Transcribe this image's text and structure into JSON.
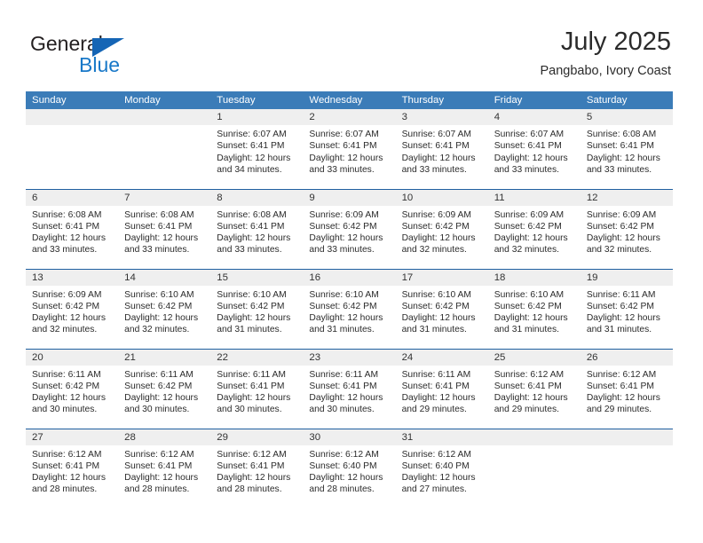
{
  "brand": {
    "name_top": "General",
    "name_bottom": "Blue",
    "accent_color": "#1878c8",
    "triangle_color": "#1565b5"
  },
  "header": {
    "title": "July 2025",
    "subtitle": "Pangbabo, Ivory Coast"
  },
  "theme": {
    "header_row_bg": "#3b7cb8",
    "row_divider": "#1f5fa0",
    "daynum_band_bg": "#efefef",
    "text_color": "#2b2b2b"
  },
  "calendar": {
    "weekday_headers": [
      "Sunday",
      "Monday",
      "Tuesday",
      "Wednesday",
      "Thursday",
      "Friday",
      "Saturday"
    ],
    "weeks": [
      [
        {
          "day": "",
          "empty": true
        },
        {
          "day": "",
          "empty": true
        },
        {
          "day": "1",
          "sunrise": "Sunrise: 6:07 AM",
          "sunset": "Sunset: 6:41 PM",
          "daylight1": "Daylight: 12 hours",
          "daylight2": "and 34 minutes."
        },
        {
          "day": "2",
          "sunrise": "Sunrise: 6:07 AM",
          "sunset": "Sunset: 6:41 PM",
          "daylight1": "Daylight: 12 hours",
          "daylight2": "and 33 minutes."
        },
        {
          "day": "3",
          "sunrise": "Sunrise: 6:07 AM",
          "sunset": "Sunset: 6:41 PM",
          "daylight1": "Daylight: 12 hours",
          "daylight2": "and 33 minutes."
        },
        {
          "day": "4",
          "sunrise": "Sunrise: 6:07 AM",
          "sunset": "Sunset: 6:41 PM",
          "daylight1": "Daylight: 12 hours",
          "daylight2": "and 33 minutes."
        },
        {
          "day": "5",
          "sunrise": "Sunrise: 6:08 AM",
          "sunset": "Sunset: 6:41 PM",
          "daylight1": "Daylight: 12 hours",
          "daylight2": "and 33 minutes."
        }
      ],
      [
        {
          "day": "6",
          "sunrise": "Sunrise: 6:08 AM",
          "sunset": "Sunset: 6:41 PM",
          "daylight1": "Daylight: 12 hours",
          "daylight2": "and 33 minutes."
        },
        {
          "day": "7",
          "sunrise": "Sunrise: 6:08 AM",
          "sunset": "Sunset: 6:41 PM",
          "daylight1": "Daylight: 12 hours",
          "daylight2": "and 33 minutes."
        },
        {
          "day": "8",
          "sunrise": "Sunrise: 6:08 AM",
          "sunset": "Sunset: 6:41 PM",
          "daylight1": "Daylight: 12 hours",
          "daylight2": "and 33 minutes."
        },
        {
          "day": "9",
          "sunrise": "Sunrise: 6:09 AM",
          "sunset": "Sunset: 6:42 PM",
          "daylight1": "Daylight: 12 hours",
          "daylight2": "and 33 minutes."
        },
        {
          "day": "10",
          "sunrise": "Sunrise: 6:09 AM",
          "sunset": "Sunset: 6:42 PM",
          "daylight1": "Daylight: 12 hours",
          "daylight2": "and 32 minutes."
        },
        {
          "day": "11",
          "sunrise": "Sunrise: 6:09 AM",
          "sunset": "Sunset: 6:42 PM",
          "daylight1": "Daylight: 12 hours",
          "daylight2": "and 32 minutes."
        },
        {
          "day": "12",
          "sunrise": "Sunrise: 6:09 AM",
          "sunset": "Sunset: 6:42 PM",
          "daylight1": "Daylight: 12 hours",
          "daylight2": "and 32 minutes."
        }
      ],
      [
        {
          "day": "13",
          "sunrise": "Sunrise: 6:09 AM",
          "sunset": "Sunset: 6:42 PM",
          "daylight1": "Daylight: 12 hours",
          "daylight2": "and 32 minutes."
        },
        {
          "day": "14",
          "sunrise": "Sunrise: 6:10 AM",
          "sunset": "Sunset: 6:42 PM",
          "daylight1": "Daylight: 12 hours",
          "daylight2": "and 32 minutes."
        },
        {
          "day": "15",
          "sunrise": "Sunrise: 6:10 AM",
          "sunset": "Sunset: 6:42 PM",
          "daylight1": "Daylight: 12 hours",
          "daylight2": "and 31 minutes."
        },
        {
          "day": "16",
          "sunrise": "Sunrise: 6:10 AM",
          "sunset": "Sunset: 6:42 PM",
          "daylight1": "Daylight: 12 hours",
          "daylight2": "and 31 minutes."
        },
        {
          "day": "17",
          "sunrise": "Sunrise: 6:10 AM",
          "sunset": "Sunset: 6:42 PM",
          "daylight1": "Daylight: 12 hours",
          "daylight2": "and 31 minutes."
        },
        {
          "day": "18",
          "sunrise": "Sunrise: 6:10 AM",
          "sunset": "Sunset: 6:42 PM",
          "daylight1": "Daylight: 12 hours",
          "daylight2": "and 31 minutes."
        },
        {
          "day": "19",
          "sunrise": "Sunrise: 6:11 AM",
          "sunset": "Sunset: 6:42 PM",
          "daylight1": "Daylight: 12 hours",
          "daylight2": "and 31 minutes."
        }
      ],
      [
        {
          "day": "20",
          "sunrise": "Sunrise: 6:11 AM",
          "sunset": "Sunset: 6:42 PM",
          "daylight1": "Daylight: 12 hours",
          "daylight2": "and 30 minutes."
        },
        {
          "day": "21",
          "sunrise": "Sunrise: 6:11 AM",
          "sunset": "Sunset: 6:42 PM",
          "daylight1": "Daylight: 12 hours",
          "daylight2": "and 30 minutes."
        },
        {
          "day": "22",
          "sunrise": "Sunrise: 6:11 AM",
          "sunset": "Sunset: 6:41 PM",
          "daylight1": "Daylight: 12 hours",
          "daylight2": "and 30 minutes."
        },
        {
          "day": "23",
          "sunrise": "Sunrise: 6:11 AM",
          "sunset": "Sunset: 6:41 PM",
          "daylight1": "Daylight: 12 hours",
          "daylight2": "and 30 minutes."
        },
        {
          "day": "24",
          "sunrise": "Sunrise: 6:11 AM",
          "sunset": "Sunset: 6:41 PM",
          "daylight1": "Daylight: 12 hours",
          "daylight2": "and 29 minutes."
        },
        {
          "day": "25",
          "sunrise": "Sunrise: 6:12 AM",
          "sunset": "Sunset: 6:41 PM",
          "daylight1": "Daylight: 12 hours",
          "daylight2": "and 29 minutes."
        },
        {
          "day": "26",
          "sunrise": "Sunrise: 6:12 AM",
          "sunset": "Sunset: 6:41 PM",
          "daylight1": "Daylight: 12 hours",
          "daylight2": "and 29 minutes."
        }
      ],
      [
        {
          "day": "27",
          "sunrise": "Sunrise: 6:12 AM",
          "sunset": "Sunset: 6:41 PM",
          "daylight1": "Daylight: 12 hours",
          "daylight2": "and 28 minutes."
        },
        {
          "day": "28",
          "sunrise": "Sunrise: 6:12 AM",
          "sunset": "Sunset: 6:41 PM",
          "daylight1": "Daylight: 12 hours",
          "daylight2": "and 28 minutes."
        },
        {
          "day": "29",
          "sunrise": "Sunrise: 6:12 AM",
          "sunset": "Sunset: 6:41 PM",
          "daylight1": "Daylight: 12 hours",
          "daylight2": "and 28 minutes."
        },
        {
          "day": "30",
          "sunrise": "Sunrise: 6:12 AM",
          "sunset": "Sunset: 6:40 PM",
          "daylight1": "Daylight: 12 hours",
          "daylight2": "and 28 minutes."
        },
        {
          "day": "31",
          "sunrise": "Sunrise: 6:12 AM",
          "sunset": "Sunset: 6:40 PM",
          "daylight1": "Daylight: 12 hours",
          "daylight2": "and 27 minutes."
        },
        {
          "day": "",
          "empty": true
        },
        {
          "day": "",
          "empty": true
        }
      ]
    ]
  }
}
